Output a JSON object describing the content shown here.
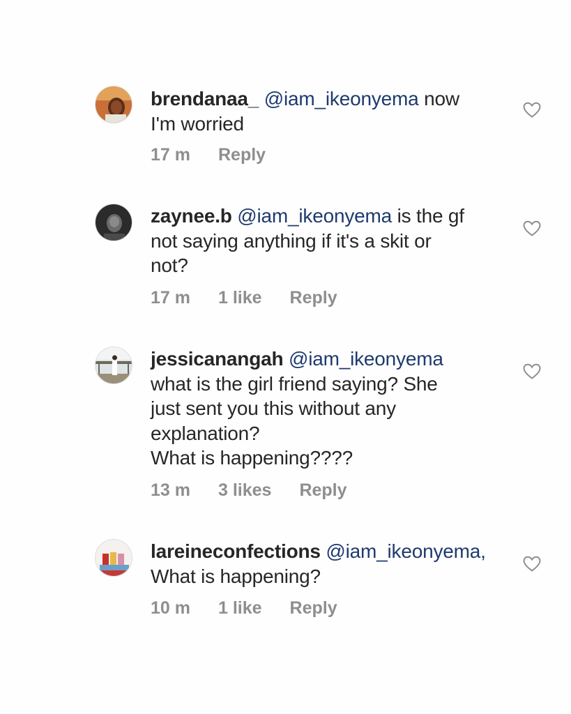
{
  "comments": [
    {
      "username": "brendanaa_",
      "mention": "@iam_ikeonyema",
      "lines": [
        "now",
        "I'm worried"
      ],
      "time": "17 m",
      "likes": "",
      "reply": "Reply"
    },
    {
      "username": "zaynee.b",
      "mention": "@iam_ikeonyema",
      "lines": [
        "is the gf",
        "not saying anything if it's a skit or",
        "not?"
      ],
      "time": "17 m",
      "likes": "1 like",
      "reply": "Reply"
    },
    {
      "username": "jessicanangah",
      "mention": "@iam_ikeonyema",
      "lines": [
        "",
        "what is the girl friend saying? She",
        "just sent you this without any",
        "explanation?",
        "What is happening????"
      ],
      "time": "13 m",
      "likes": "3 likes",
      "reply": "Reply"
    },
    {
      "username": "lareineconfections",
      "mention": "@iam_ikeonyema,",
      "lines": [
        "",
        "What is happening?"
      ],
      "time": "10 m",
      "likes": "1 like",
      "reply": "Reply"
    }
  ],
  "icons": {
    "like": "heart-outline-icon"
  },
  "colors": {
    "mention": "#1e3a6e",
    "meta": "#8e8e8e",
    "text": "#262626"
  }
}
